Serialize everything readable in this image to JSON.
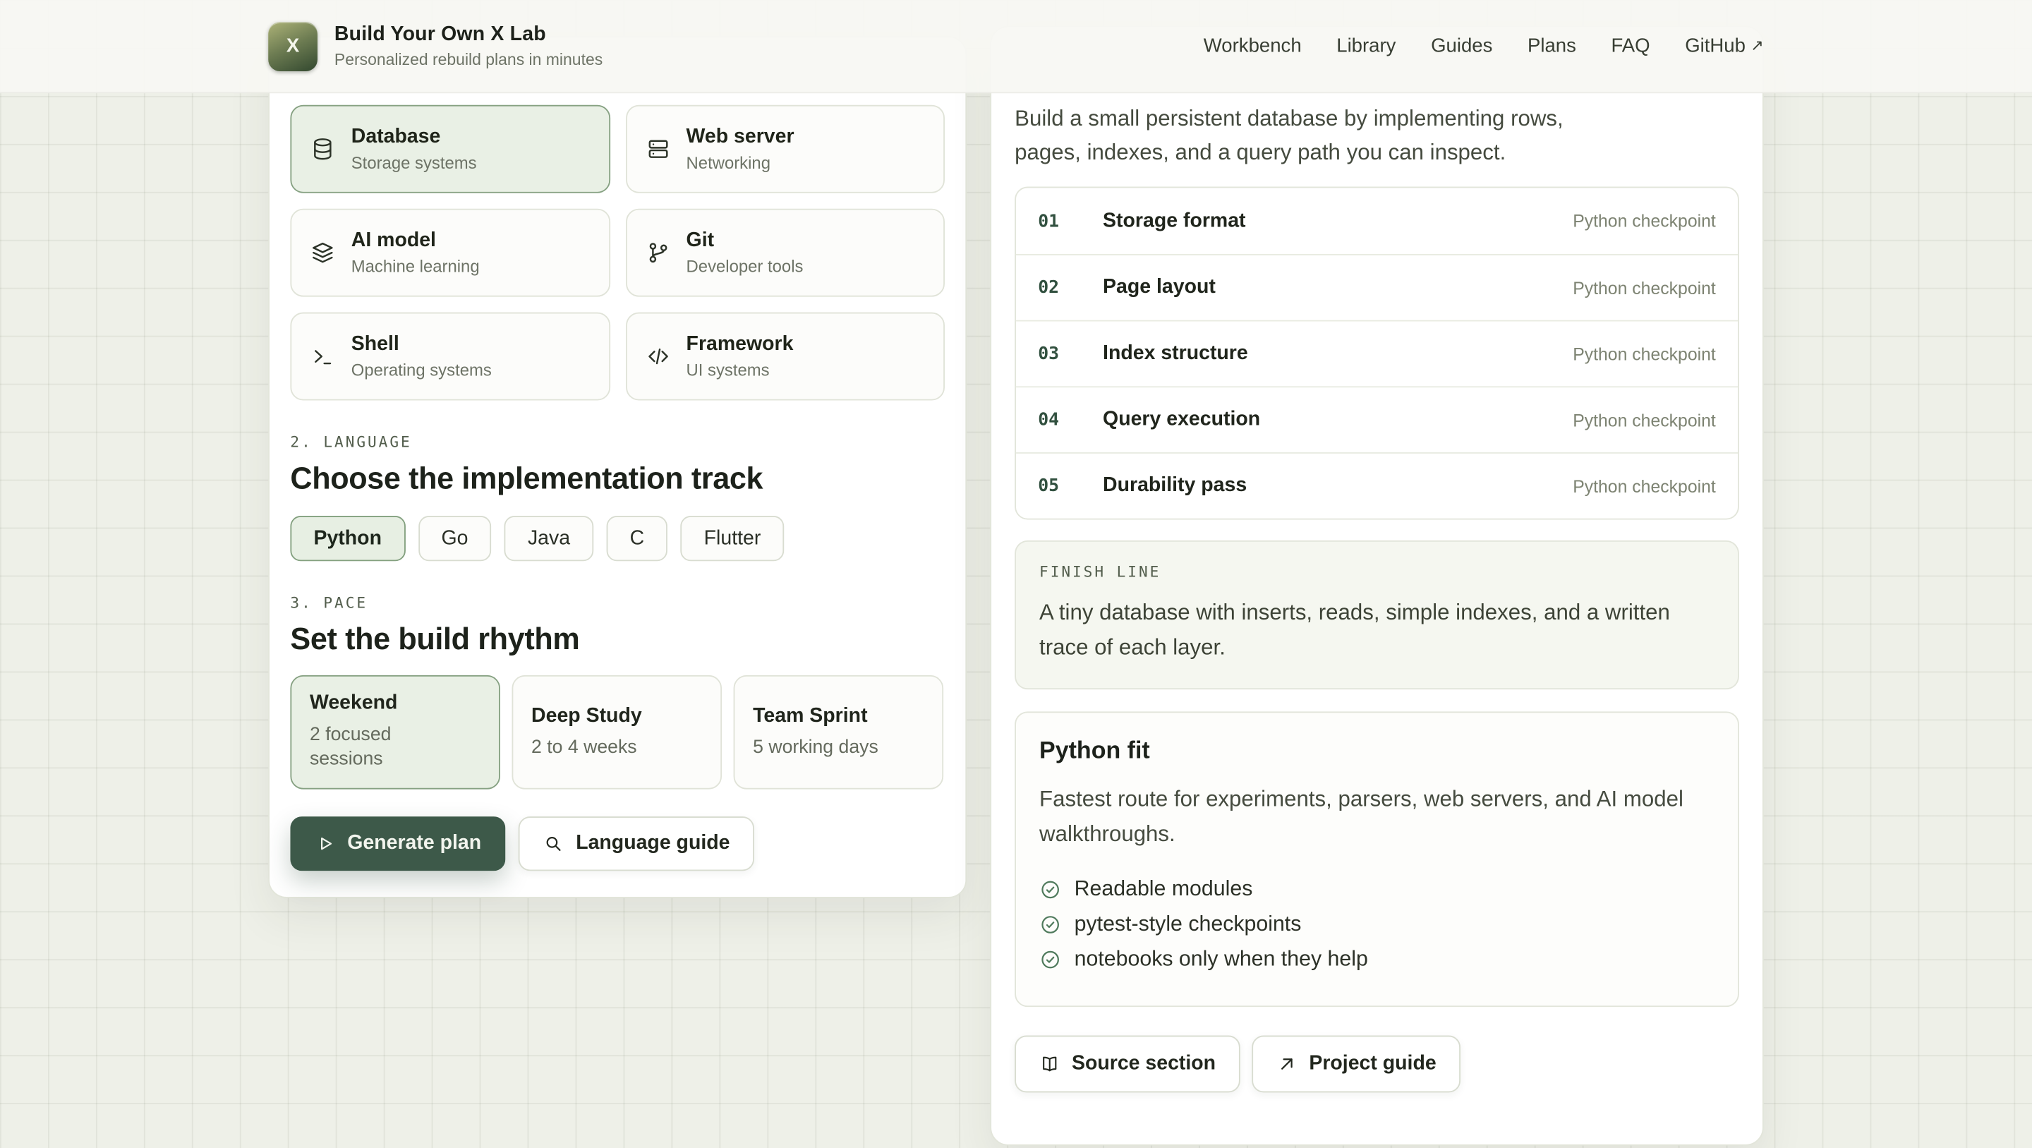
{
  "header": {
    "logo_letter": "X",
    "title": "Build Your Own X Lab",
    "subtitle": "Personalized rebuild plans in minutes",
    "nav": [
      "Workbench",
      "Library",
      "Guides",
      "Plans",
      "FAQ"
    ],
    "github_label": "GitHub",
    "github_arrow": "↗"
  },
  "builder": {
    "topics": [
      {
        "title": "Database",
        "subtitle": "Storage systems",
        "icon": "database-icon",
        "selected": true
      },
      {
        "title": "Web server",
        "subtitle": "Networking",
        "icon": "server-icon",
        "selected": false
      },
      {
        "title": "AI model",
        "subtitle": "Machine learning",
        "icon": "layers-icon",
        "selected": false
      },
      {
        "title": "Git",
        "subtitle": "Developer tools",
        "icon": "git-branch-icon",
        "selected": false
      },
      {
        "title": "Shell",
        "subtitle": "Operating systems",
        "icon": "terminal-icon",
        "selected": false
      },
      {
        "title": "Framework",
        "subtitle": "UI systems",
        "icon": "code-icon",
        "selected": false
      }
    ],
    "language": {
      "label": "2. LANGUAGE",
      "heading": "Choose the implementation track",
      "options": [
        "Python",
        "Go",
        "Java",
        "C",
        "Flutter"
      ],
      "selected": "Python"
    },
    "pace": {
      "label": "3. PACE",
      "heading": "Set the build rhythm",
      "options": [
        {
          "title": "Weekend",
          "detail": "2 focused sessions",
          "selected": true
        },
        {
          "title": "Deep Study",
          "detail": "2 to 4 weeks",
          "selected": false
        },
        {
          "title": "Team Sprint",
          "detail": "5 working days",
          "selected": false
        }
      ]
    },
    "actions": {
      "generate": "Generate plan",
      "guide": "Language guide"
    }
  },
  "plan": {
    "intro": "Build a small persistent database by implementing rows, pages, indexes, and a query path you can inspect.",
    "steps": [
      {
        "num": "01",
        "title": "Storage format",
        "tag": "Python checkpoint"
      },
      {
        "num": "02",
        "title": "Page layout",
        "tag": "Python checkpoint"
      },
      {
        "num": "03",
        "title": "Index structure",
        "tag": "Python checkpoint"
      },
      {
        "num": "04",
        "title": "Query execution",
        "tag": "Python checkpoint"
      },
      {
        "num": "05",
        "title": "Durability pass",
        "tag": "Python checkpoint"
      }
    ],
    "finish": {
      "label": "FINISH LINE",
      "text": "A tiny database with inserts, reads, simple indexes, and a written trace of each layer."
    },
    "fit": {
      "heading": "Python fit",
      "text": "Fastest route for experiments, parsers, web servers, and AI model walkthroughs.",
      "points": [
        "Readable modules",
        "pytest-style checkpoints",
        "notebooks only when they help"
      ]
    },
    "actions": {
      "source": "Source section",
      "guide": "Project guide"
    }
  },
  "colors": {
    "accent_dark_green": "#3d5949",
    "selected_bg": "#e9f0e5",
    "selected_border": "#86a182",
    "page_bg": "#eef0e8",
    "card_bg": "#ffffff"
  }
}
